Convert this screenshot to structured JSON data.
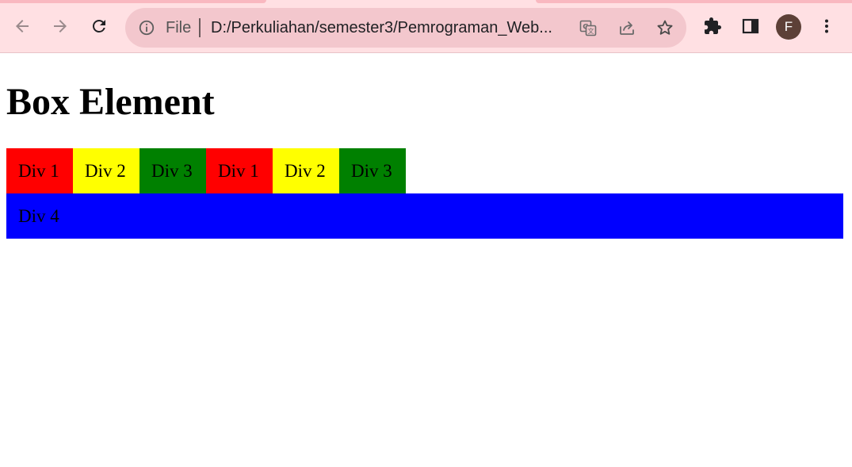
{
  "browser": {
    "omnibox": {
      "scheme_label": "File",
      "url": "D:/Perkuliahan/semester3/Pemrograman_Web..."
    },
    "profile": {
      "initial": "F",
      "color": "#5d4037"
    },
    "toolbar_color": "#ffe0e3",
    "icons": [
      "back-arrow-icon",
      "forward-arrow-icon",
      "reload-icon",
      "info-icon",
      "translate-icon",
      "share-icon",
      "star-icon",
      "extensions-puzzle-icon",
      "side-panel-icon",
      "kebab-menu-icon"
    ]
  },
  "page": {
    "heading": "Box Element",
    "boxes": [
      {
        "label": "Div 1",
        "color": "#ff0000"
      },
      {
        "label": "Div 2",
        "color": "#ffff00"
      },
      {
        "label": "Div 3",
        "color": "#008000"
      },
      {
        "label": "Div 1",
        "color": "#ff0000"
      },
      {
        "label": "Div 2",
        "color": "#ffff00"
      },
      {
        "label": "Div 3",
        "color": "#008000"
      }
    ],
    "wide_box": {
      "label": "Div 4",
      "color": "#0000ff"
    }
  }
}
